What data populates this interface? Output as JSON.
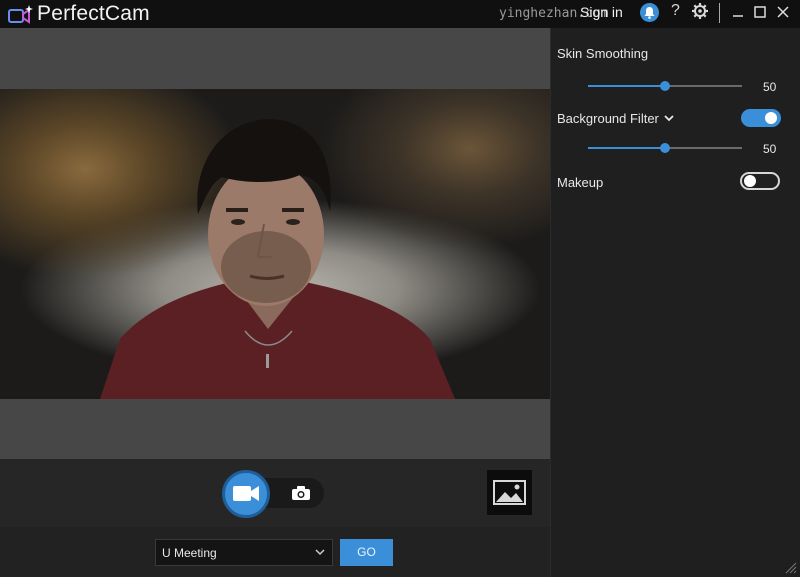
{
  "app": {
    "title": "PerfectCam"
  },
  "watermark": "yinghezhan.com",
  "header": {
    "signin_label": "Sign in",
    "help_label": "?"
  },
  "panel": {
    "skin_smoothing": {
      "label": "Skin Smoothing",
      "value": "50",
      "fraction": 0.5
    },
    "background_filter": {
      "label": "Background Filter",
      "value": "50",
      "fraction": 0.5,
      "enabled": true
    },
    "makeup": {
      "label": "Makeup",
      "enabled": false
    }
  },
  "meeting": {
    "selected": "U Meeting",
    "go_label": "GO"
  },
  "colors": {
    "accent": "#3b8fd9",
    "titlebar": "#101010",
    "panel": "#1f1f1f",
    "preview_frame": "#474747"
  },
  "icons": [
    "perfectcam-logo-icon",
    "bell-icon",
    "gear-icon",
    "minimize-icon",
    "maximize-icon",
    "close-icon",
    "video-camera-icon",
    "photo-camera-icon",
    "gallery-icon",
    "chevron-down-icon",
    "resize-grip-icon"
  ]
}
